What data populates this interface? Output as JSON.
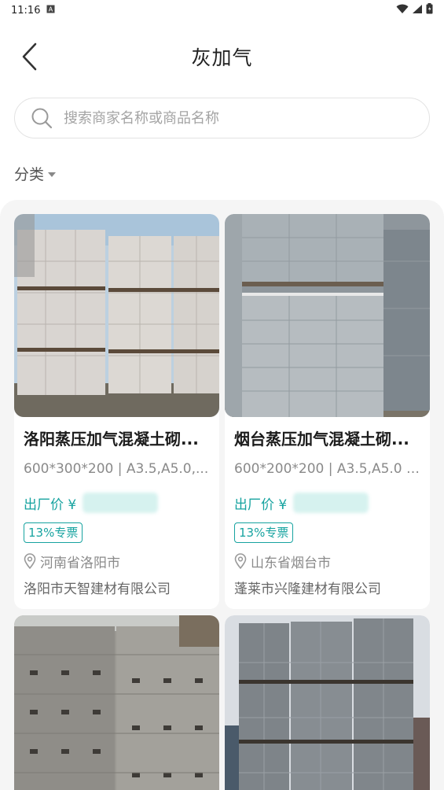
{
  "status_bar": {
    "time": "11:16",
    "notification_icon": "a-box-icon",
    "wifi_icon": "wifi-icon",
    "signal_icon": "signal-icon",
    "battery_icon": "battery-icon"
  },
  "header": {
    "title": "灰加气",
    "back_icon": "chevron-left-icon"
  },
  "search": {
    "placeholder": "搜索商家名称或商品名称",
    "value": ""
  },
  "filter": {
    "category_label": "分类"
  },
  "colors": {
    "accent": "#17a3a0",
    "grid_bg": "#f5f5f5"
  },
  "products": [
    {
      "title": "洛阳蒸压加气混凝土砌...",
      "spec": "600*300*200 | A3.5,A5.0,...",
      "price_label": "出厂价 ¥",
      "tag": "13%专票",
      "location": "河南省洛阳市",
      "company": "洛阳市天智建材有限公司"
    },
    {
      "title": "烟台蒸压加气混凝土砌...",
      "spec": "600*200*200 | A3.5,A5.0 |...",
      "price_label": "出厂价 ¥",
      "tag": "13%专票",
      "location": "山东省烟台市",
      "company": "蓬莱市兴隆建材有限公司"
    }
  ]
}
